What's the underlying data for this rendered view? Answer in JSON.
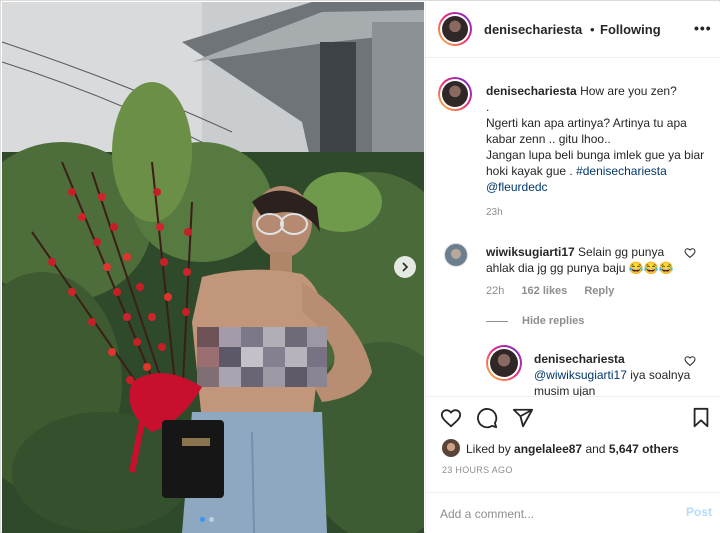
{
  "post_header": {
    "username": "denisechariesta",
    "separator": "•",
    "follow_status": "Following",
    "more_glyph": "•••"
  },
  "caption": {
    "username": "denisechariesta",
    "line1": "How are you zen?",
    "line2": ".",
    "line3": "Ngerti kan apa artinya? Artinya tu apa kabar zenn .. gitu lhoo..",
    "line4": "Jangan lupa beli bunga imlek gue ya biar hoki kayak gue .",
    "hashtag": "#denisechariesta",
    "mention": "@fleurdedc",
    "time": "23h"
  },
  "comment1": {
    "username": "wiwiksugiarti17",
    "text": "Selain gg punya ahlak dia jg gg punya baju 😂😂😂",
    "time": "22h",
    "likes": "162 likes",
    "reply": "Reply",
    "hide_replies": "Hide replies"
  },
  "reply1": {
    "username": "denisechariesta",
    "mention": "@wiwiksugiarti17",
    "text": "iya soalnya musim ujan"
  },
  "likes": {
    "prefix": "Liked by",
    "user": "angelalee87",
    "joiner": "and",
    "others": "5,647 others"
  },
  "timestamp": "23 HOURS AGO",
  "add_comment": {
    "placeholder": "Add a comment...",
    "post_label": "Post"
  },
  "carousel": {
    "slides": 2,
    "active": 1
  },
  "icons": {
    "heart": "heart-icon",
    "comment": "comment-icon",
    "share": "share-icon",
    "save": "bookmark-icon",
    "next": "chevron-right-icon"
  },
  "colors": {
    "text": "#262626",
    "muted": "#8e8e8e",
    "link": "#00376b",
    "accent": "#3897f0",
    "post_disabled": "#b3dbff"
  }
}
